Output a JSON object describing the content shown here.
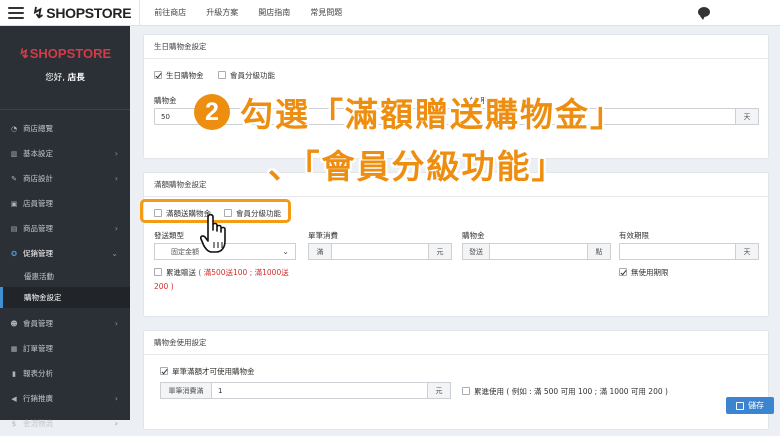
{
  "brand": {
    "logo_text": "SHOPSTORE",
    "logo_mark": "↯"
  },
  "topnav": [
    "前往商店",
    "升級方案",
    "開店指南",
    "常見問題"
  ],
  "sidebar": {
    "greeting": "您好,",
    "user": "店長",
    "items": [
      {
        "label": "商店總覽",
        "icon": "dashboard-icon",
        "glyph": "◔",
        "has_arrow": false
      },
      {
        "label": "基本設定",
        "icon": "bank-icon",
        "glyph": "▥",
        "has_arrow": true
      },
      {
        "label": "商店設計",
        "icon": "brush-icon",
        "glyph": "✎",
        "has_arrow": true
      },
      {
        "label": "店員管理",
        "icon": "staff-icon",
        "glyph": "▣",
        "has_arrow": false
      },
      {
        "label": "商品管理",
        "icon": "cart-icon",
        "glyph": "▤",
        "has_arrow": true
      },
      {
        "label": "促銷管理",
        "icon": "promo-icon",
        "glyph": "✪",
        "has_arrow": true,
        "expanded": true
      }
    ],
    "sub_items": [
      "優惠活動",
      "購物金設定"
    ],
    "items_after": [
      {
        "label": "會員管理",
        "icon": "users-icon",
        "glyph": "☻",
        "has_arrow": true
      },
      {
        "label": "訂單管理",
        "icon": "orders-icon",
        "glyph": "▦",
        "has_arrow": false
      },
      {
        "label": "報表分析",
        "icon": "chart-icon",
        "glyph": "▮",
        "has_arrow": false
      },
      {
        "label": "行銷推廣",
        "icon": "megaphone-icon",
        "glyph": "◀",
        "has_arrow": true
      },
      {
        "label": "金流物流",
        "icon": "money-icon",
        "glyph": "$",
        "has_arrow": true
      }
    ]
  },
  "birthday": {
    "title": "生日購物金設定",
    "cb_birthday": "生日購物金",
    "cb_member_level": "會員分級功能",
    "label_amount": "購物金",
    "amount_value": "50",
    "label_validity": "有效期限",
    "validity_unit": "天"
  },
  "spend": {
    "title": "滿額購物金設定",
    "cb_spend": "滿額送購物金",
    "cb_member_level": "會員分級功能",
    "label_issue_type": "發送類型",
    "issue_type_value": "固定金額",
    "label_single": "單筆消費",
    "single_prefix": "滿",
    "single_unit": "元",
    "label_amount": "購物金",
    "amount_prefix": "發送",
    "amount_unit": "點",
    "label_validity": "有效期限",
    "validity_unit": "天",
    "cb_cumulative": "累進贈送",
    "cumulative_note": "( 滿500送100 ; 滿1000送",
    "cumulative_note2": "200 )",
    "cb_unlimited": "無使用期限"
  },
  "usage": {
    "title": "購物金使用設定",
    "cb_min_order": "單筆滿額才可使用購物金",
    "label_min_order": "單筆消費滿",
    "min_order_value": "1",
    "min_order_unit": "元",
    "cb_cumulative_use": "累進使用 ( 例如 : 滿 500 可用 100 ; 滿 1000 可用 200 )"
  },
  "annotation": {
    "number": "2",
    "line1": "勾選「滿額贈送購物金」",
    "line2": "、「會員分級功能」"
  },
  "save_button": "儲存",
  "colors": {
    "accent": "#ee8e11",
    "sidebar_bg": "#2b3036",
    "brand_red": "#d63a46",
    "primary": "#3b84cf"
  }
}
